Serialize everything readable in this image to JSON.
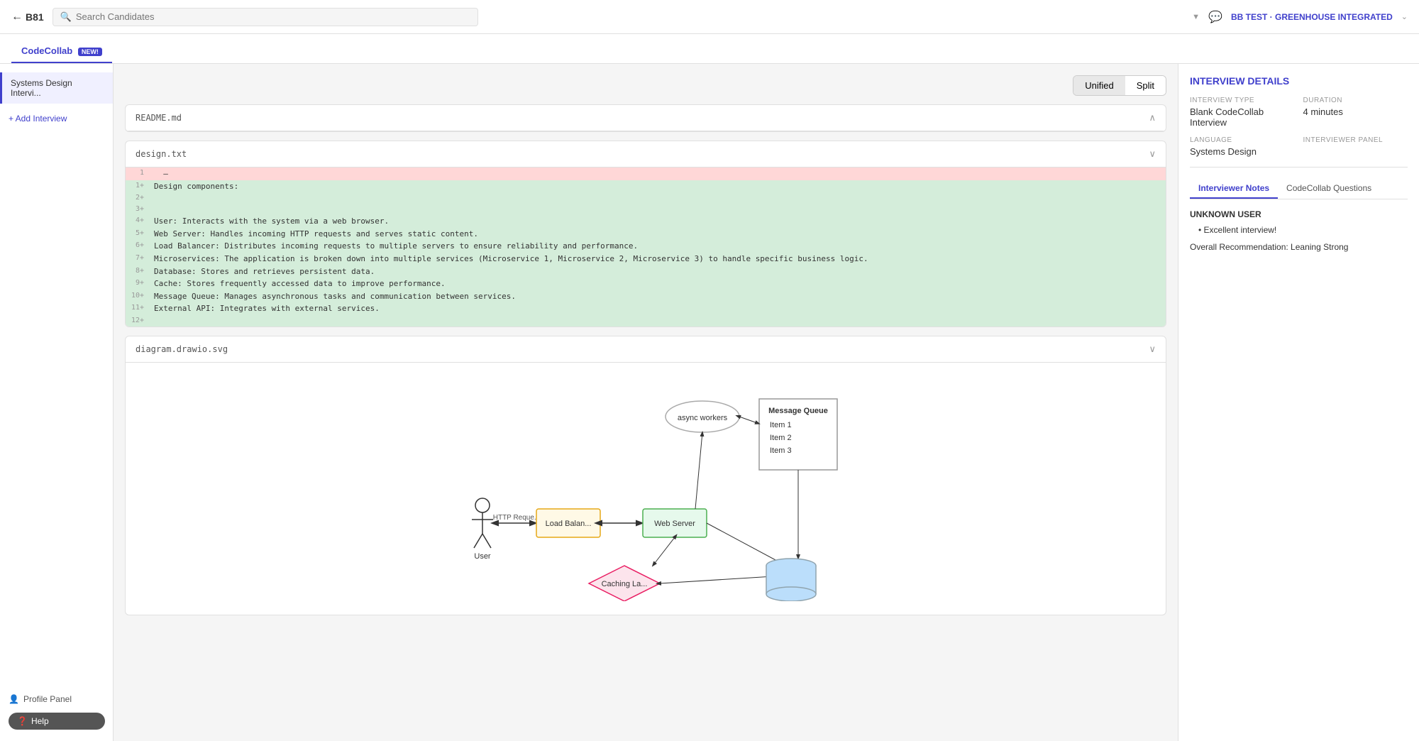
{
  "topnav": {
    "back_label": "B81",
    "search_placeholder": "Search Candidates",
    "org_label": "BB TEST · GREENHOUSE INTEGRATED"
  },
  "tabbar": {
    "tabs": [
      {
        "id": "codecollab",
        "label": "CodeCollab",
        "badge": "NEW!",
        "active": true
      }
    ]
  },
  "sidebar": {
    "interview_label": "Systems Design Intervi...",
    "add_interview_label": "+ Add Interview"
  },
  "view_toggle": {
    "unified_label": "Unified",
    "split_label": "Split"
  },
  "files": [
    {
      "name": "README.md",
      "collapsed": true,
      "lines": []
    },
    {
      "name": "design.txt",
      "collapsed": false,
      "lines": [
        {
          "num": "1",
          "type": "removed",
          "content": "–"
        },
        {
          "num": "1+",
          "type": "added",
          "content": "Design components:"
        },
        {
          "num": "2+",
          "type": "added",
          "content": ""
        },
        {
          "num": "3+",
          "type": "added",
          "content": ""
        },
        {
          "num": "4+",
          "type": "added",
          "content": "User: Interacts with the system via a web browser."
        },
        {
          "num": "5+",
          "type": "added",
          "content": "Web Server: Handles incoming HTTP requests and serves static content."
        },
        {
          "num": "6+",
          "type": "added",
          "content": "Load Balancer: Distributes incoming requests to multiple servers to ensure reliability and performance."
        },
        {
          "num": "7+",
          "type": "added",
          "content": "Microservices: The application is broken down into multiple services (Microservice 1, Microservice 2, Microservice 3) to handle specific business logic."
        },
        {
          "num": "8+",
          "type": "added",
          "content": "Database: Stores and retrieves persistent data."
        },
        {
          "num": "9+",
          "type": "added",
          "content": "Cache: Stores frequently accessed data to improve performance."
        },
        {
          "num": "10+",
          "type": "added",
          "content": "Message Queue: Manages asynchronous tasks and communication between services."
        },
        {
          "num": "11+",
          "type": "added",
          "content": "External API: Integrates with external services."
        },
        {
          "num": "12+",
          "type": "added",
          "content": ""
        }
      ]
    },
    {
      "name": "diagram.drawio.svg",
      "collapsed": false,
      "has_diagram": true
    }
  ],
  "right_panel": {
    "title": "INTERVIEW DETAILS",
    "interview_type_label": "INTERVIEW TYPE",
    "interview_type_value": "Blank CodeCollab Interview",
    "duration_label": "DURATION",
    "duration_value": "4 minutes",
    "language_label": "LANGUAGE",
    "language_value": "Systems Design",
    "interviewer_panel_label": "INTERVIEWER PANEL",
    "tabs": [
      {
        "id": "notes",
        "label": "Interviewer Notes",
        "active": true
      },
      {
        "id": "questions",
        "label": "CodeCollab Questions"
      }
    ],
    "user_label": "UNKNOWN USER",
    "note": "Excellent interview!",
    "recommendation": "Overall Recommendation: Leaning Strong"
  },
  "bottom": {
    "profile_label": "Profile Panel",
    "help_label": "Help"
  }
}
